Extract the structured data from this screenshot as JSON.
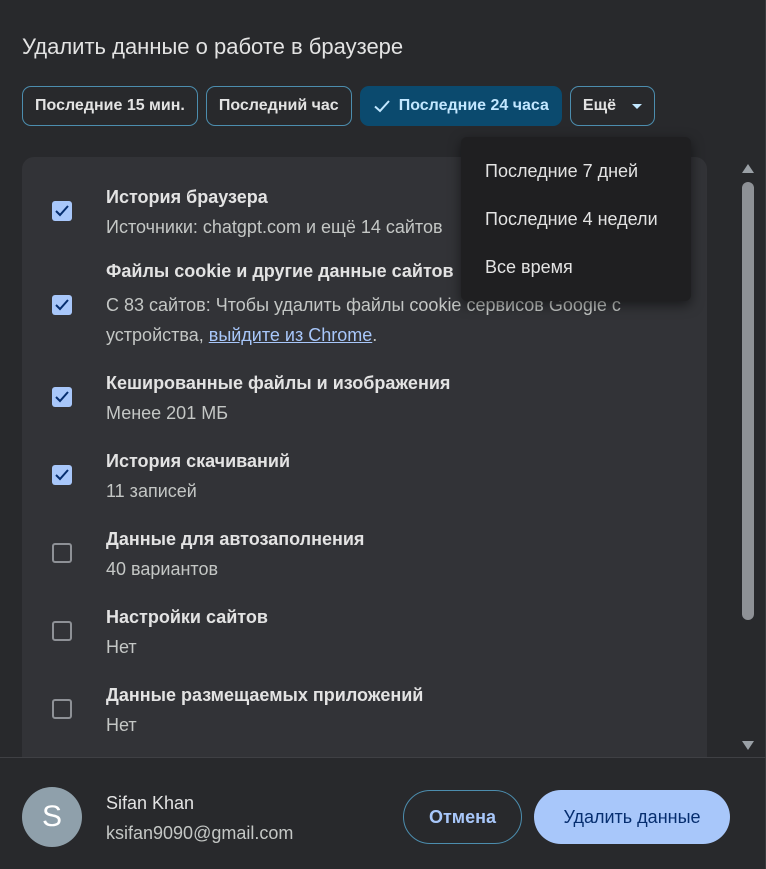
{
  "dialog": {
    "title": "Удалить данные о работе в браузере"
  },
  "time_range": {
    "chips": [
      {
        "label": "Последние 15 мин.",
        "selected": false
      },
      {
        "label": "Последний час",
        "selected": false
      },
      {
        "label": "Последние 24 часа",
        "selected": true
      },
      {
        "label": "Ещё",
        "selected": false
      }
    ],
    "more_menu": [
      {
        "label": "Последние 7 дней"
      },
      {
        "label": "Последние 4 недели"
      },
      {
        "label": "Все время"
      }
    ]
  },
  "items": [
    {
      "title": "История браузера",
      "subtitle": "Источники: chatgpt.com и ещё 14 сайтов",
      "checked": true
    },
    {
      "title": "Файлы cookie и другие данные сайтов",
      "subtitle_prefix": "С 83 сайтов: Чтобы удалить файлы cookie сервисов Google с устройства,",
      "subtitle_link": "выйдите из Chrome",
      "subtitle_suffix": ".",
      "checked": true
    },
    {
      "title": "Кешированные файлы и изображения",
      "subtitle": "Менее 201 МБ",
      "checked": true
    },
    {
      "title": "История скачиваний",
      "subtitle": "11 записей",
      "checked": true
    },
    {
      "title": "Данные для автозаполнения",
      "subtitle": "40 вариантов",
      "checked": false
    },
    {
      "title": "Настройки сайтов",
      "subtitle": "Нет",
      "checked": false
    },
    {
      "title": "Данные размещаемых приложений",
      "subtitle": "Нет",
      "checked": false
    }
  ],
  "account": {
    "avatar_letter": "S",
    "name": "Sifan Khan",
    "email": "ksifan9090@gmail.com"
  },
  "buttons": {
    "cancel": "Отмена",
    "delete": "Удалить данные"
  },
  "colors": {
    "accent": "#a8c7fa",
    "selected_chip": "#0b4a6e",
    "background": "#28292c",
    "panel": "#323337"
  }
}
